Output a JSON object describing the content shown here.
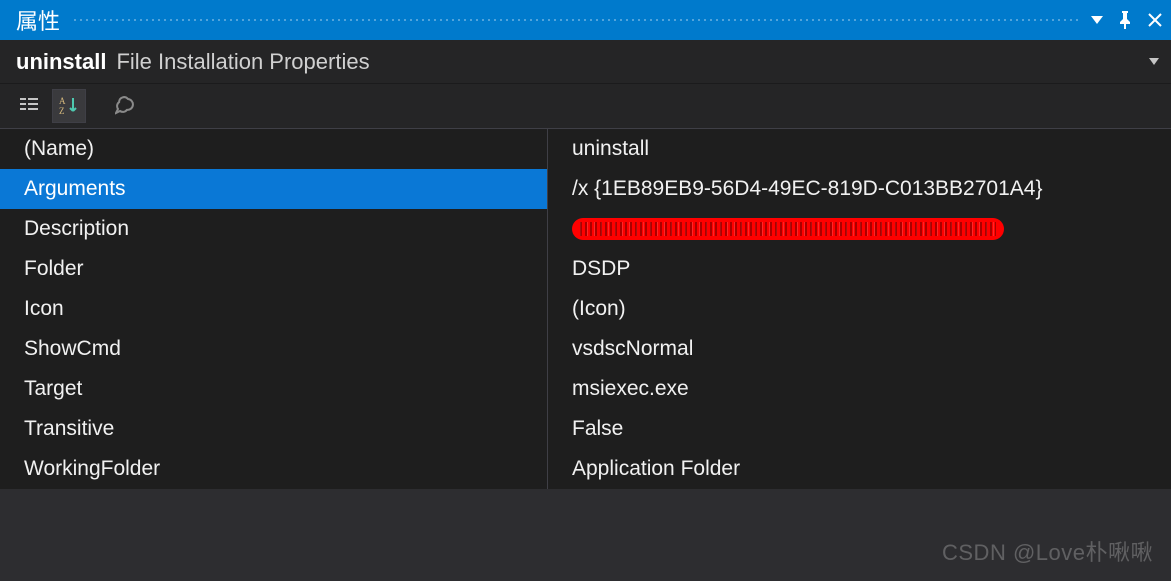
{
  "titlebar": {
    "title": "属性"
  },
  "subheader": {
    "object": "uninstall",
    "type": "File Installation Properties"
  },
  "toolbar": {
    "categorized_name": "categorized-icon",
    "alpha_name": "alphabetical-icon",
    "wrench_name": "properties-icon"
  },
  "grid": {
    "rows": [
      {
        "name": "(Name)",
        "value": "uninstall",
        "selected": false,
        "redacted": false
      },
      {
        "name": "Arguments",
        "value": "/x {1EB89EB9-56D4-49EC-819D-C013BB2701A4}",
        "selected": true,
        "redacted": false
      },
      {
        "name": "Description",
        "value": "",
        "selected": false,
        "redacted": true
      },
      {
        "name": "Folder",
        "value": "DSDP",
        "selected": false,
        "redacted": false
      },
      {
        "name": "Icon",
        "value": "(Icon)",
        "selected": false,
        "redacted": false
      },
      {
        "name": "ShowCmd",
        "value": "vsdscNormal",
        "selected": false,
        "redacted": false
      },
      {
        "name": "Target",
        "value": "msiexec.exe",
        "selected": false,
        "redacted": false
      },
      {
        "name": "Transitive",
        "value": "False",
        "selected": false,
        "redacted": false
      },
      {
        "name": "WorkingFolder",
        "value": "Application Folder",
        "selected": false,
        "redacted": false
      }
    ]
  },
  "watermark": "CSDN @Love朴啾啾"
}
